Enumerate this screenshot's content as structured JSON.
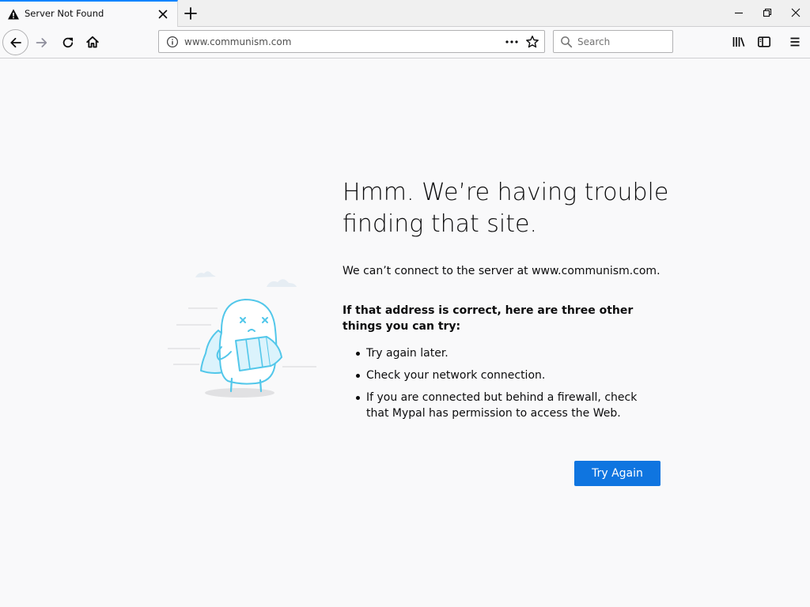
{
  "colors": {
    "accent": "#0a84ff",
    "button": "#0f75e0",
    "page_background": "#f9f9fa",
    "text": "#0c0c0d",
    "illustration_stroke": "#52c7ea"
  },
  "tab": {
    "title": "Server Not Found",
    "icon": "warning-icon",
    "close_icon": "close-icon"
  },
  "new_tab": {
    "icon": "plus-icon"
  },
  "window_controls": {
    "minimize_icon": "minimize-icon",
    "restore_icon": "restore-icon",
    "close_icon": "window-close-icon"
  },
  "toolbar": {
    "back_icon": "back-arrow-icon",
    "forward_icon": "forward-arrow-icon",
    "reload_icon": "reload-icon",
    "home_icon": "home-icon",
    "url": "www.communism.com",
    "site_info_icon": "info-icon",
    "page_actions_icon": "more-dots-icon",
    "bookmark_icon": "star-icon",
    "search_placeholder": "Search",
    "search_icon": "search-icon",
    "library_icon": "library-icon",
    "sidebar_icon": "sidebar-icon",
    "menu_icon": "hamburger-menu-icon"
  },
  "error_page": {
    "title": "Hmm. We’re having trouble finding that site.",
    "description": "We can’t connect to the server at www.communism.com.",
    "tips_heading": "If that address is correct, here are three other things you can try:",
    "tips": [
      "Try again later.",
      "Check your network connection.",
      "If you are connected but behind a firewall, check that Mypal has permission to access the Web."
    ],
    "try_again_label": "Try Again"
  }
}
